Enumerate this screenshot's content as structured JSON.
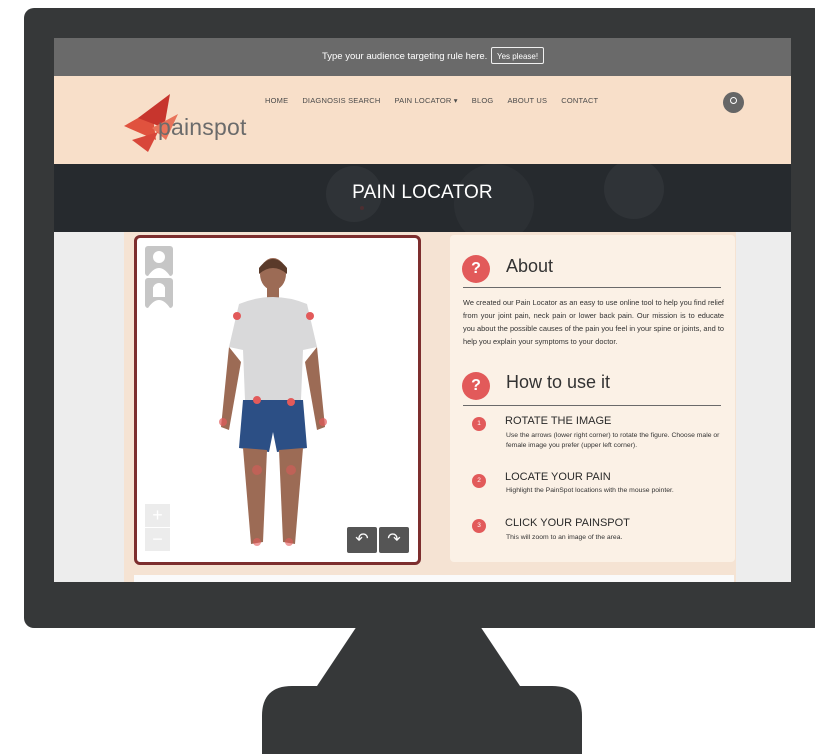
{
  "banner": {
    "text": "Type your audience targeting rule here.",
    "button_label": "Yes please!"
  },
  "brand": {
    "name": "painspot",
    "accent_color": "#e25a5a"
  },
  "nav": {
    "items": [
      {
        "label": "Home"
      },
      {
        "label": "Diagnosis Search"
      },
      {
        "label": "Pain Locator ▾"
      },
      {
        "label": "Blog"
      },
      {
        "label": "About Us"
      },
      {
        "label": "Contact"
      }
    ],
    "search_icon": "search-icon"
  },
  "hero": {
    "title": "PAIN LOCATOR"
  },
  "figure_panel": {
    "avatar_icons": [
      "male-avatar-icon",
      "female-avatar-icon"
    ],
    "zoom_in": "+",
    "zoom_out": "−",
    "rotate_left": "↶",
    "rotate_right": "↷"
  },
  "about": {
    "title": "About",
    "icon": "?",
    "text": "We created our Pain Locator as an easy to use online tool to help you find relief from your joint pain, neck pain or lower back pain. Our mission is to educate you about the possible causes of the pain you feel in your spine or joints, and to help you explain your symptoms to your doctor."
  },
  "how_to": {
    "title": "How to use it",
    "icon": "?",
    "steps": [
      {
        "num": "1",
        "title": "ROTATE THE IMAGE",
        "desc": "Use the arrows (lower right corner) to rotate the figure. Choose male or female image you prefer (upper left corner)."
      },
      {
        "num": "2",
        "title": "LOCATE YOUR PAIN",
        "desc": "Highlight the PainSpot locations with the mouse pointer."
      },
      {
        "num": "3",
        "title": "CLICK YOUR PAINSPOT",
        "desc": "This will zoom to an image of the area."
      }
    ]
  }
}
